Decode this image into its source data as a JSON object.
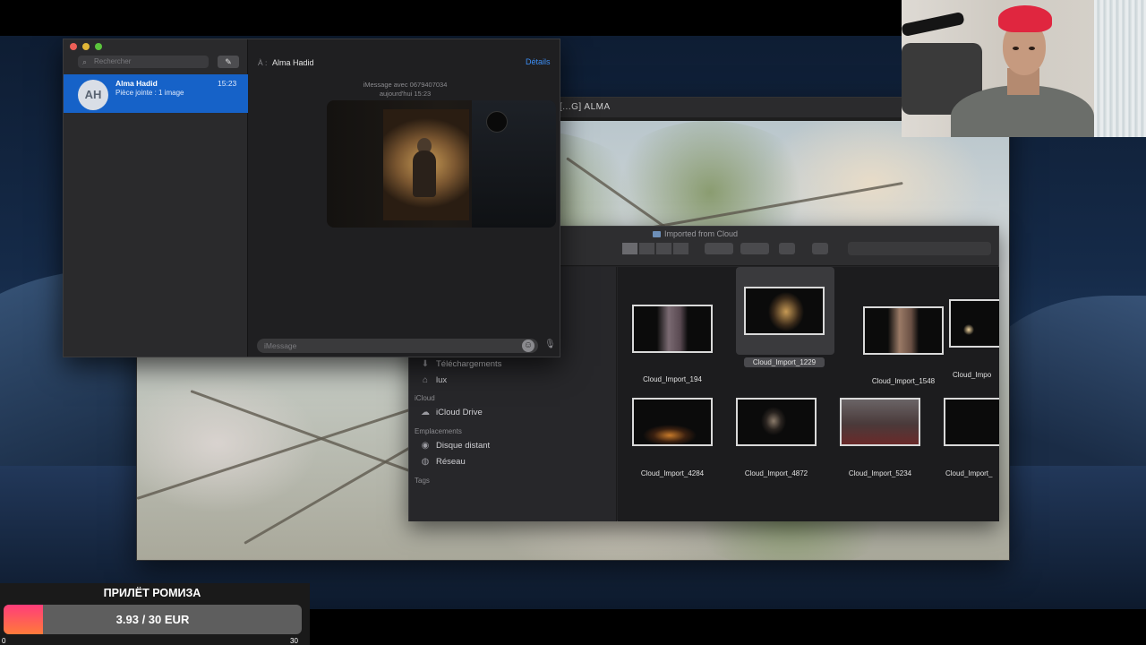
{
  "messages": {
    "search_placeholder": "Rechercher",
    "conversation": {
      "initials": "AH",
      "name": "Alma Hadid",
      "preview": "Pièce jointe : 1 image",
      "time": "15:23"
    },
    "to_label": "À :",
    "to_name": "Alma Hadid",
    "details": "Détails",
    "meta_line1": "iMessage avec 0679407034",
    "meta_line2": "aujourd'hui 15:23",
    "input_placeholder": "iMessage",
    "accent": "#1662c8"
  },
  "photo_window": {
    "title": "[...G] ALMA"
  },
  "finder": {
    "title": "Imported from Cloud",
    "sidebar": {
      "items_top": [
        {
          "icon": "download-icon",
          "label": "Téléchargements"
        },
        {
          "icon": "home-icon",
          "label": "lux"
        }
      ],
      "icloud_header": "iCloud",
      "icloud_items": [
        {
          "icon": "cloud-icon",
          "label": "iCloud Drive"
        }
      ],
      "locations_header": "Emplacements",
      "location_items": [
        {
          "icon": "disk-icon",
          "label": "Disque distant"
        },
        {
          "icon": "network-icon",
          "label": "Réseau"
        }
      ],
      "tags_header": "Tags"
    },
    "files_row1": [
      "Cloud_Import_194",
      "Cloud_Import_1229",
      "Cloud_Import_1548",
      "Cloud_Impo"
    ],
    "files_row2": [
      "Cloud_Import_4284",
      "Cloud_Import_4872",
      "Cloud_Import_5234",
      "Cloud_Import_"
    ],
    "selected_file": "Cloud_Import_1229"
  },
  "donation": {
    "title": "ПРИЛЁТ РОМИЗА",
    "progress_text": "3.93 / 30 EUR",
    "current": 3.93,
    "goal": 30,
    "min_label": "0",
    "max_label": "30",
    "fill_color_start": "#ff3d7a",
    "fill_color_end": "#ff7a3a"
  }
}
